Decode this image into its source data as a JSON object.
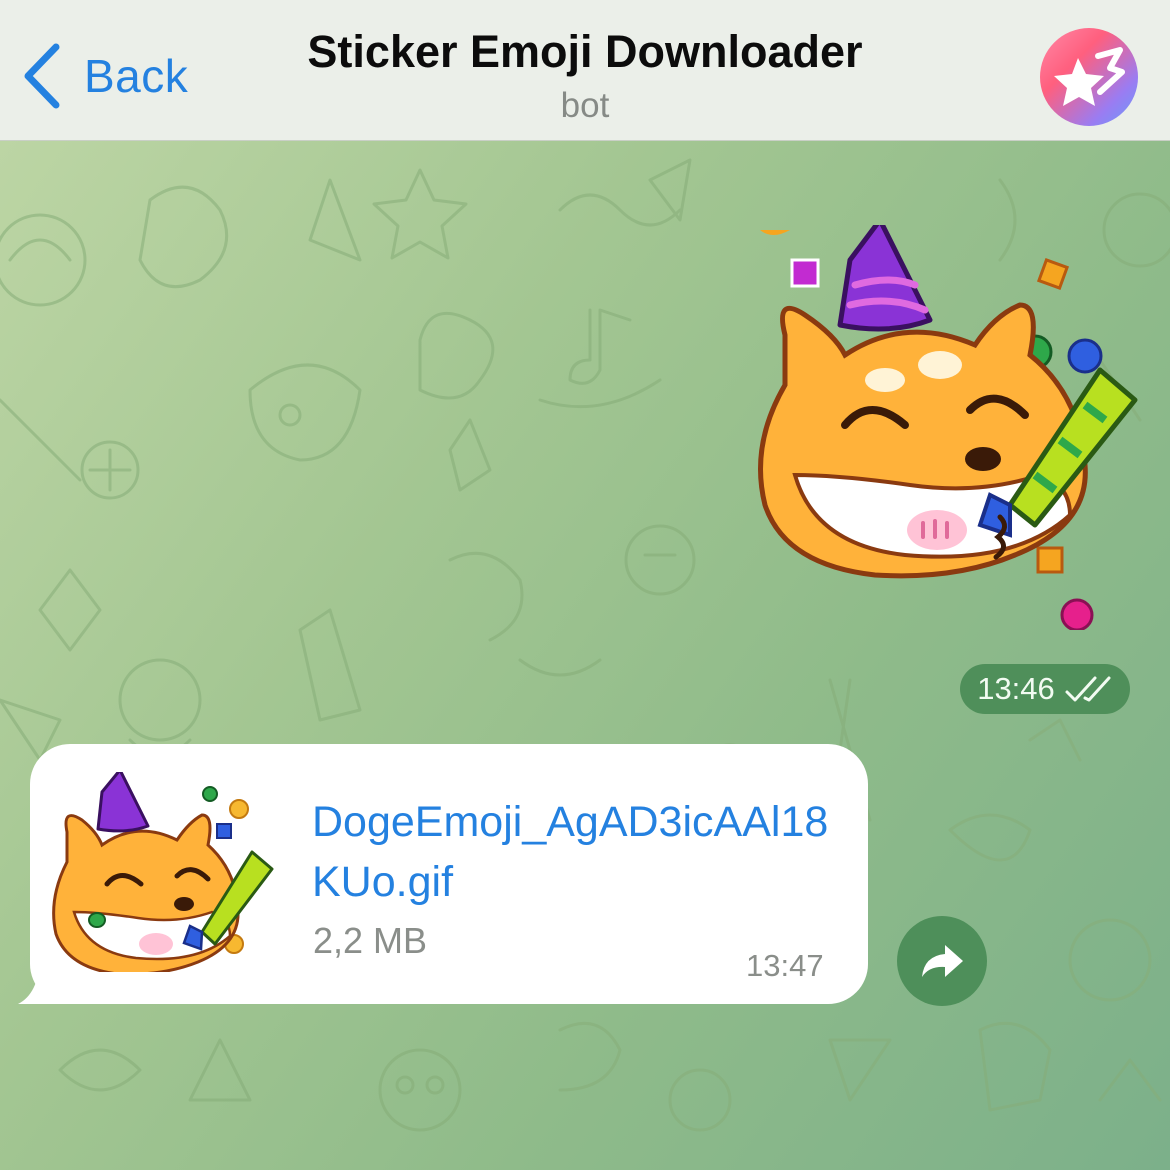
{
  "colors": {
    "accent": "#2481e0",
    "pill": "#4f8f5a",
    "bubble": "#ffffff"
  },
  "nav": {
    "back_label": "Back",
    "back_icon": "chevron-left-icon",
    "title": "Sticker Emoji Downloader",
    "subtitle": "bot",
    "avatar_icon": "star-avatar-icon"
  },
  "messages": {
    "outgoing": {
      "type": "sticker",
      "sticker_icon": "party-doge-sticker",
      "time": "13:46",
      "status_icon": "double-check-icon"
    },
    "incoming": {
      "type": "file",
      "thumbnail_icon": "party-doge-thumbnail",
      "file_name": "DogeEmoji_AgAD3icAAl18KUo.gif",
      "file_size": "2,2 MB",
      "time": "13:47",
      "forward_icon": "share-arrow-icon"
    }
  }
}
